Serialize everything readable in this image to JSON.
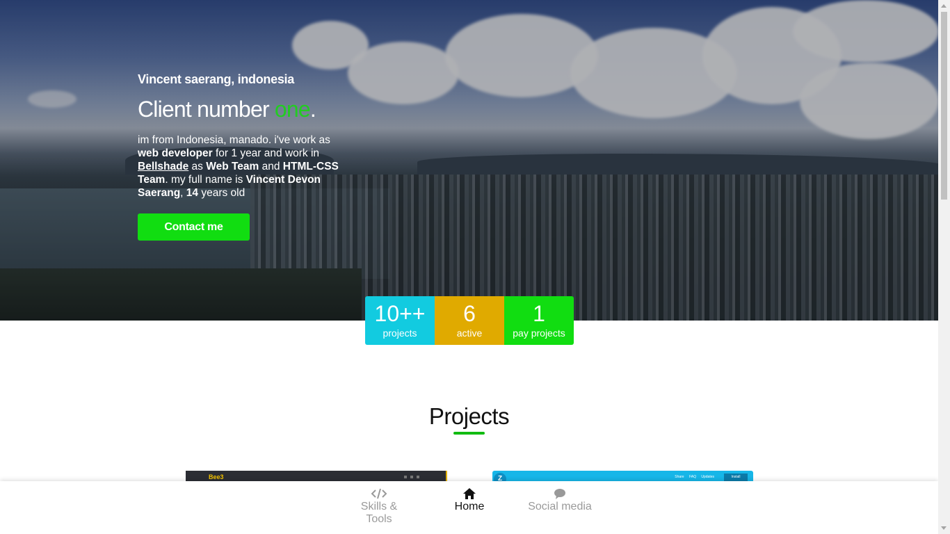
{
  "hero": {
    "location": "Vincent saerang, indonesia",
    "headline_main": "Client number ",
    "headline_accent": "one",
    "headline_end": ".",
    "bio": {
      "p1": "im from Indonesia, manado. i've work as ",
      "b1": "web developer",
      "p2": " for 1 year and work in ",
      "link": "Bellshade",
      "p3": " as ",
      "b2": "Web Team",
      "p4": " and ",
      "b3": "HTML-CSS Team",
      "p5": ". my full name is ",
      "b4": "Vincent Devon Saerang",
      "p6": ", ",
      "b5": "14",
      "p7": " years old"
    },
    "contact_label": "Contact me"
  },
  "stats": [
    {
      "value": "10++",
      "label": "projects",
      "color": "#12cbe0"
    },
    {
      "value": "6",
      "label": "active",
      "color": "#e0aa00"
    },
    {
      "value": "1",
      "label": "pay projects",
      "color": "#11dd11"
    }
  ],
  "projects": {
    "title": "Projects",
    "cards": [
      {
        "brand": "Bee3",
        "icon": "bee3-logo"
      },
      {
        "logo_letter": "Z",
        "nav": "Share FAQ Updates",
        "install": "Install"
      }
    ]
  },
  "bottom_nav": [
    {
      "label": "Skills & Tools",
      "icon": "code-icon",
      "active": false
    },
    {
      "label": "Home",
      "icon": "home-icon",
      "active": true
    },
    {
      "label": "Social media",
      "icon": "chat-bubble-icon",
      "active": false
    }
  ],
  "colors": {
    "accent_green": "#11dd11",
    "cyan": "#12cbe0",
    "yellow": "#e0aa00"
  }
}
